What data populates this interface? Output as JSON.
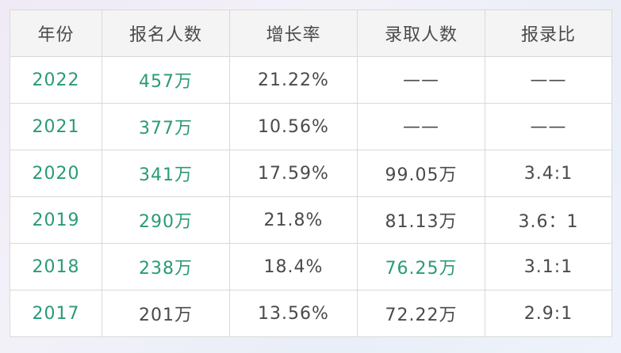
{
  "table": {
    "headers": [
      "年份",
      "报名人数",
      "增长率",
      "录取人数",
      "报录比"
    ],
    "rows": [
      [
        "2022",
        "457万",
        "21.22%",
        "——",
        "——"
      ],
      [
        "2021",
        "377万",
        "10.56%",
        "——",
        "——"
      ],
      [
        "2020",
        "341万",
        "17.59%",
        "99.05万",
        "3.4:1"
      ],
      [
        "2019",
        "290万",
        "21.8%",
        "81.13万",
        "3.6：1"
      ],
      [
        "2018",
        "238万",
        "18.4%",
        "76.25万",
        "3.1:1"
      ],
      [
        "2017",
        "201万",
        "13.56%",
        "72.22万",
        "2.9:1"
      ]
    ]
  },
  "colors": {
    "accent": "#2a9a78",
    "text": "#4a4a4a",
    "header_bg": "#f4f4f4",
    "border": "#d9d9d9"
  }
}
